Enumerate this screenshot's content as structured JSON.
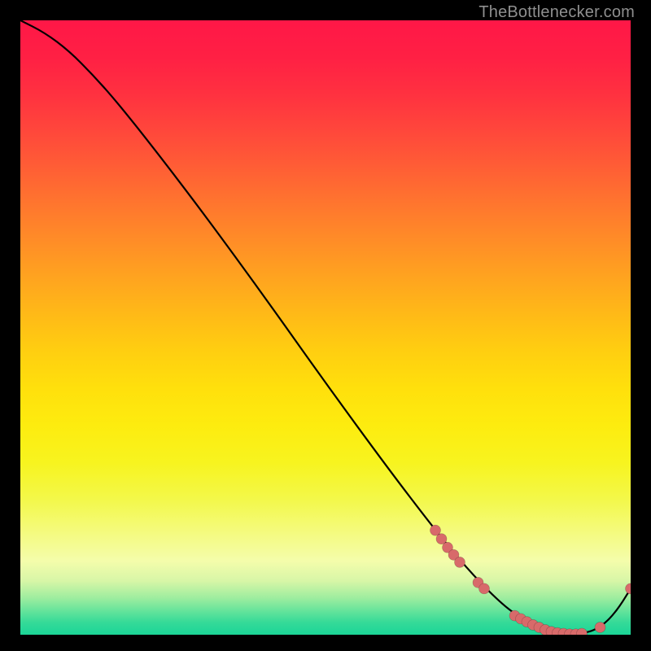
{
  "attribution": "TheBottlenecker.com",
  "colors": {
    "bg": "#000000",
    "curve": "#000000",
    "marker_fill": "#d86a6a",
    "marker_stroke": "rgba(0,0,0,0.25)",
    "grad_stops": [
      {
        "offset": 0.0,
        "color": "#ff1747"
      },
      {
        "offset": 0.06,
        "color": "#ff2044"
      },
      {
        "offset": 0.12,
        "color": "#ff3140"
      },
      {
        "offset": 0.18,
        "color": "#ff473b"
      },
      {
        "offset": 0.24,
        "color": "#ff5e35"
      },
      {
        "offset": 0.3,
        "color": "#ff762e"
      },
      {
        "offset": 0.36,
        "color": "#ff8d27"
      },
      {
        "offset": 0.42,
        "color": "#ffa41f"
      },
      {
        "offset": 0.48,
        "color": "#ffba17"
      },
      {
        "offset": 0.54,
        "color": "#ffcf10"
      },
      {
        "offset": 0.6,
        "color": "#ffe00c"
      },
      {
        "offset": 0.66,
        "color": "#fdec0f"
      },
      {
        "offset": 0.72,
        "color": "#f7f41f"
      },
      {
        "offset": 0.78,
        "color": "#f3f84a"
      },
      {
        "offset": 0.84,
        "color": "#f4fb85"
      },
      {
        "offset": 0.88,
        "color": "#f4fdab"
      },
      {
        "offset": 0.912,
        "color": "#d8f6a7"
      },
      {
        "offset": 0.94,
        "color": "#9eed9f"
      },
      {
        "offset": 0.962,
        "color": "#63e39b"
      },
      {
        "offset": 0.98,
        "color": "#35da98"
      },
      {
        "offset": 1.0,
        "color": "#1bd597"
      }
    ]
  },
  "chart_data": {
    "type": "line",
    "title": "",
    "xlabel": "",
    "ylabel": "",
    "xlim": [
      0,
      100
    ],
    "ylim": [
      0,
      100
    ],
    "series": [
      {
        "name": "bottleneck-curve",
        "x": [
          0,
          4,
          8,
          12,
          16,
          22,
          30,
          40,
          50,
          60,
          68,
          73,
          78,
          82,
          86,
          88,
          90,
          92,
          94,
          96,
          98,
          100
        ],
        "y": [
          100,
          98,
          95,
          91,
          86.5,
          79,
          68.6,
          55,
          41,
          27.4,
          17.0,
          11.0,
          5.8,
          2.6,
          0.8,
          0.3,
          0.1,
          0.2,
          0.7,
          2.0,
          4.3,
          7.5
        ]
      }
    ],
    "markers": {
      "name": "highlighted-points",
      "x": [
        68,
        69,
        70,
        71,
        72,
        75,
        76,
        81,
        82,
        83,
        84,
        85,
        86,
        87,
        88,
        89,
        90,
        91,
        92,
        95,
        100
      ],
      "y": [
        17.0,
        15.6,
        14.2,
        13.0,
        11.8,
        8.5,
        7.5,
        3.1,
        2.6,
        2.1,
        1.6,
        1.2,
        0.8,
        0.5,
        0.3,
        0.2,
        0.1,
        0.1,
        0.2,
        1.2,
        7.5
      ]
    }
  }
}
